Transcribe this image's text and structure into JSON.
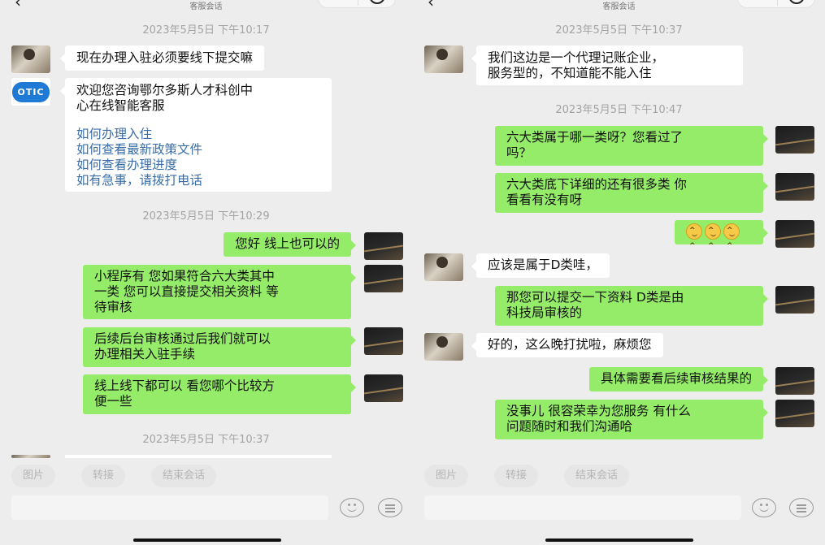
{
  "header": {
    "subtitle": "客服会话"
  },
  "left": {
    "timestamps": [
      "2023年5月5日 下午10:17",
      "2023年5月5日 下午10:29",
      "2023年5月5日 下午10:37"
    ],
    "otic_logo_text": "OTIC",
    "msg_user_1": "现在办理入驻必须要线下提交嘛",
    "welcome": {
      "lines": [
        "欢迎您咨询鄂尔多斯人才科创中",
        "心在线智能客服"
      ],
      "links": [
        "如何办理入住",
        "如何查看最新政策文件",
        "如何查看办理进度",
        "如有急事，请拨打电话"
      ]
    },
    "msg_agent_1": "您好 线上也可以的",
    "msg_agent_2": [
      "小程序有 您如果符合六大类其中",
      "一类 您可以直接提交相关资料 等",
      "待审核"
    ],
    "msg_agent_3": [
      "后续后台审核通过后我们就可以",
      "办理相关入驻手续"
    ],
    "msg_agent_4": [
      "线上线下都可以 看您哪个比较方",
      "便一些"
    ]
  },
  "right": {
    "timestamps": [
      "2023年5月5日 下午10:37",
      "2023年5月5日 下午10:47"
    ],
    "msg_user_1": [
      "我们这边是一个代理记账企业，",
      "服务型的，不知道能不能入住"
    ],
    "msg_agent_1": [
      "六大类属于哪一类呀？您看过了",
      "吗？"
    ],
    "msg_agent_2": [
      "六大类底下详细的还有很多类 你",
      "看看有没有呀"
    ],
    "emoji_count": 3,
    "msg_user_2": "应该是属于D类哇，",
    "msg_agent_3": [
      "那您可以提交一下资料 D类是由",
      "科技局审核的"
    ],
    "msg_user_3": "好的，这么晚打扰啦，麻烦您",
    "msg_agent_4": "具体需要看后续审核结果的",
    "msg_agent_5": [
      "没事儿 很容荣幸为您服务 有什么",
      "问题随时和我们沟通哈"
    ]
  },
  "quick_actions": [
    "图片",
    "转接",
    "结束会话"
  ],
  "icons": {
    "back": "back-arrow-icon",
    "more": "more-dots-icon",
    "target": "target-icon",
    "emoji": "emoji-icon",
    "menu": "menu-icon"
  },
  "colors": {
    "background": "#ededed",
    "outgoing_bubble": "#95ec69",
    "incoming_bubble": "#ffffff",
    "link": "#3b6ea8",
    "logo": "#1f7ad6"
  }
}
